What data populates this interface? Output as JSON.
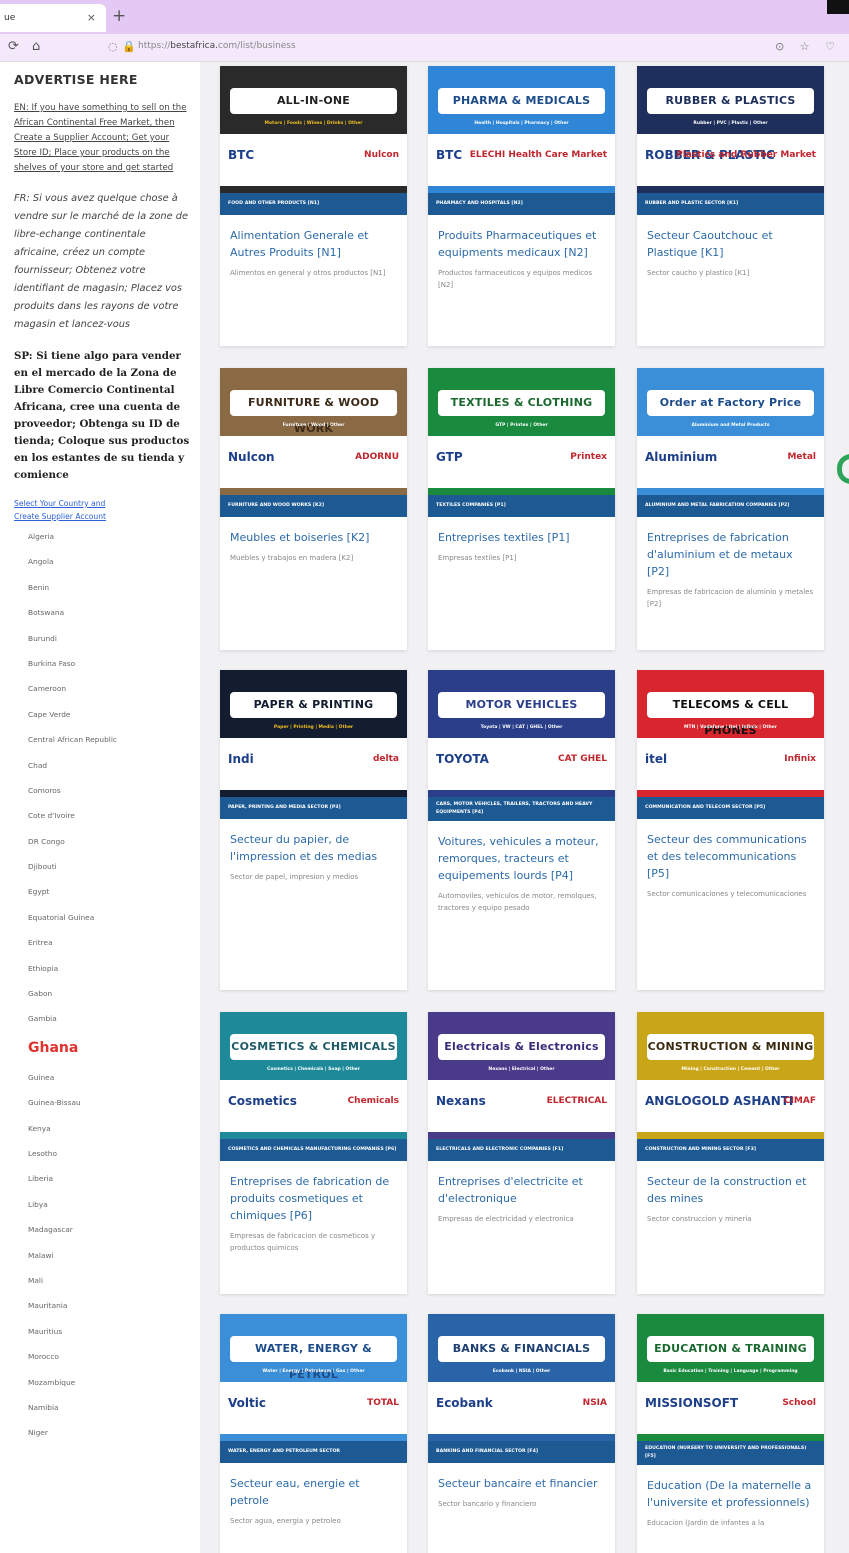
{
  "browser": {
    "tab_title": "ue",
    "tab_close": "×",
    "new_tab": "+",
    "nav_back": "⟳",
    "home": "⌂",
    "url_prefix": "https://",
    "url_domain": "bestafrica.",
    "url_path": "com/list/business",
    "shield": "◌",
    "lock": "🔒",
    "right_icons": "⊙ ☆ ♡"
  },
  "sidebar": {
    "advertise_title": "ADVERTISE HERE",
    "en_text": "EN: If you have something to sell on the African Continental Free Market, then Create a Supplier Account; Get your Store ID; Place your products on the shelves of your store and get started",
    "fr_text": "FR: Si vous avez quelque chose à vendre sur le marché de la zone de libre-echange continentale africaine, créez un compte fournisseur; Obtenez votre identifiant de magasin; Placez vos produits dans les rayons de votre magasin et lancez-vous",
    "sp_text": "SP: Si tiene algo para vender en el mercado de la Zona de Libre Comercio Continental Africana, cree una cuenta de proveedor; Obtenga su ID de tienda; Coloque sus productos en los estantes de su tienda y comience",
    "select_link_1": "Select Your Country and",
    "select_link_2": "Create Supplier Account",
    "countries": [
      "Algeria",
      "Angola",
      "Benin",
      "Botswana",
      "Burundi",
      "Burkina Faso",
      "Cameroon",
      "Cape Verde",
      "Central African Republic",
      "Chad",
      "Comoros",
      "Cote d'Ivoire",
      "DR Congo",
      "Djibouti",
      "Egypt",
      "Equatorial Guinea",
      "Eritrea",
      "Ethiopia",
      "Gabon",
      "Gambia",
      "Ghana",
      "Guinea",
      "Guinea-Bissau",
      "Kenya",
      "Lesotho",
      "Liberia",
      "Libya",
      "Madagascar",
      "Malawi",
      "Mali",
      "Mauritania",
      "Mauritius",
      "Morocco",
      "Mozambique",
      "Namibia",
      "Niger"
    ]
  },
  "cards": [
    {
      "banner_title": "ALL-IN-ONE",
      "banner_sub": "Motors | Foods | Wines | Drinks | Other",
      "logo_a": "BTC",
      "logo_b": "Nulcon",
      "caption": "FOOD AND OTHER PRODUCTS [N1]",
      "title": "Alimentation Generale et Autres Produits [N1]",
      "desc": "Alimentos en general y otros productos [N1]",
      "bg": "#2a2a2a",
      "title_color": "#222",
      "sub_color": "#f0c020"
    },
    {
      "banner_title": "PHARMA & MEDICALS",
      "banner_sub": "Health | Hospitals | Pharmacy | Other",
      "logo_a": "BTC",
      "logo_b": "ELECHI Health Care Market",
      "caption": "PHARMACY AND HOSPITALS [N2]",
      "title": "Produits Pharmaceutiques et equipments medicaux [N2]",
      "desc": "Productos farmaceuticos y equipos medicos [N2]",
      "bg": "#2f86d6",
      "title_color": "#1d4c8a",
      "sub_color": "#fff"
    },
    {
      "banner_title": "RUBBER & PLASTICS",
      "banner_sub": "Rubber | PVC | Plastic | Other",
      "logo_a": "ROBBER & PLASTIC",
      "logo_b": "Plastics and Rubber Market",
      "caption": "RUBBER AND PLASTIC SECTOR [K1]",
      "title": "Secteur Caoutchouc et Plastique [K1]",
      "desc": "Sector caucho y plastico [K1]",
      "bg": "#1e2f5c",
      "title_color": "#1e2f5c",
      "sub_color": "#fff"
    },
    {
      "banner_title": "FURNITURE & WOOD WORK",
      "banner_sub": "Furniture | Wood | Other",
      "logo_a": "Nulcon",
      "logo_b": "ADORNU",
      "caption": "FURNITURE AND WOOD WORKS [K2]",
      "title": "Meubles et boiseries [K2]",
      "desc": "Muebles y trabajos en madera [K2]",
      "bg": "#8a6a45",
      "title_color": "#3b2a17",
      "sub_color": "#fff"
    },
    {
      "banner_title": "TEXTILES & CLOTHING",
      "banner_sub": "GTP | Printex | Other",
      "logo_a": "GTP",
      "logo_b": "Printex",
      "caption": "TEXTILES COMPANIES [P1]",
      "title": "Entreprises textiles [P1]",
      "desc": "Empresas textiles [P1]",
      "bg": "#1a8a3f",
      "title_color": "#1a6a30",
      "sub_color": "#fff"
    },
    {
      "banner_title": "Order at Factory Price",
      "banner_sub": "Aluminium and Metal Products",
      "logo_a": "Aluminium",
      "logo_b": "Metal",
      "caption": "ALUMINIUM AND METAL FABRICATION COMPANIES [P2]",
      "title": "Entreprises de fabrication d'aluminium et de metaux [P2]",
      "desc": "Empresas de fabricacion de aluminio y metales [P2]",
      "bg": "#3b8fd8",
      "title_color": "#1d4c8a",
      "sub_color": "#fff"
    },
    {
      "banner_title": "PAPER & PRINTING",
      "banner_sub": "Paper | Printing | Media | Other",
      "logo_a": "Indi",
      "logo_b": "delta",
      "caption": "PAPER, PRINTING AND MEDIA SECTOR [P3]",
      "title": "Secteur du papier, de l'impression et des medias",
      "desc": "Sector de papel, impresion y medios",
      "bg": "#141c30",
      "title_color": "#141c30",
      "sub_color": "#f0c020"
    },
    {
      "banner_title": "MOTOR VEHICLES",
      "banner_sub": "Toyota | VW | CAT | GHEL | Other",
      "logo_a": "TOYOTA",
      "logo_b": "CAT GHEL",
      "caption": "CARS, MOTOR VEHICLES, TRAILERS, TRACTORS AND HEAVY EQUIPMENTS [P4]",
      "title": "Voitures, vehicules a moteur, remorques, tracteurs et equipements lourds [P4]",
      "desc": "Automoviles, vehiculos de motor, remolques, tractores y equipo pesado",
      "bg": "#2a3e8a",
      "title_color": "#2a3e8a",
      "sub_color": "#fff"
    },
    {
      "banner_title": "TELECOMS & CELL PHONES",
      "banner_sub": "MTN | Vodafone | itel | Infinix | Other",
      "logo_a": "itel",
      "logo_b": "Infinix",
      "caption": "COMMUNICATION AND TELECOM SECTOR [P5]",
      "title": "Secteur des communications et des telecommunications [P5]",
      "desc": "Sector comunicaciones y telecomunicaciones",
      "bg": "#d7262d",
      "title_color": "#111",
      "sub_color": "#fff"
    },
    {
      "banner_title": "COSMETICS & CHEMICALS",
      "banner_sub": "Cosmetics | Chemicals | Soap | Other",
      "logo_a": "Cosmetics",
      "logo_b": "Chemicals",
      "caption": "COSMETICS AND CHEMICALS MANUFACTURING COMPANIES [P6]",
      "title": "Entreprises de fabrication de produits cosmetiques et chimiques [P6]",
      "desc": "Empresas de fabricacion de cosmeticos y productos quimicos",
      "bg": "#1e8a99",
      "title_color": "#1e5a66",
      "sub_color": "#fff"
    },
    {
      "banner_title": "Electricals & Electronics",
      "banner_sub": "Nexans | Electrical | Other",
      "logo_a": "Nexans",
      "logo_b": "ELECTRICAL",
      "caption": "ELECTRICALS AND ELECTRONIC COMPANIES [F1]",
      "title": "Entreprises d'electricite et d'electronique",
      "desc": "Empresas de electricidad y electronica",
      "bg": "#4a3a8a",
      "title_color": "#3a2a7a",
      "sub_color": "#fff"
    },
    {
      "banner_title": "CONSTRUCTION & MINING",
      "banner_sub": "Mining | Construction | Cement | Other",
      "logo_a": "ANGLOGOLD ASHANTI",
      "logo_b": "CIMAF",
      "caption": "CONSTRUCTION AND MINING SECTOR [F3]",
      "title": "Secteur de la construction et des mines",
      "desc": "Sector construccion y mineria",
      "bg": "#c9a618",
      "title_color": "#3a2a10",
      "sub_color": "#fff"
    },
    {
      "banner_title": "WATER, ENERGY & PETROL",
      "banner_sub": "Water | Energy | Petroleum | Gas | Other",
      "logo_a": "Voltic",
      "logo_b": "TOTAL",
      "caption": "WATER, ENERGY AND PETROLEUM SECTOR",
      "title": "Secteur eau, energie et petrole",
      "desc": "Sector agua, energia y petroleo",
      "bg": "#3b8fd8",
      "title_color": "#1d4c8a",
      "sub_color": "#fff"
    },
    {
      "banner_title": "BANKS & FINANCIALS",
      "banner_sub": "Ecobank | NSIA | Other",
      "logo_a": "Ecobank",
      "logo_b": "NSIA",
      "caption": "BANKING AND FINANCIAL SECTOR [F4]",
      "title": "Secteur bancaire et financier",
      "desc": "Sector bancario y financiero",
      "bg": "#2a64a8",
      "title_color": "#1d3f73",
      "sub_color": "#fff"
    },
    {
      "banner_title": "EDUCATION & TRAINING",
      "banner_sub": "Basic Education | Training | Language | Programming",
      "logo_a": "MISSIONSOFT",
      "logo_b": "School",
      "caption": "EDUCATION (NURSERY TO UNIVERSITY AND PROFESSIONALS) [F5]",
      "title": "Education (De la maternelle a l'universite et professionnels)",
      "desc": "Educacion (Jardin de infantes a la",
      "bg": "#1a8a3f",
      "title_color": "#1a6a30",
      "sub_color": "#fff"
    }
  ]
}
